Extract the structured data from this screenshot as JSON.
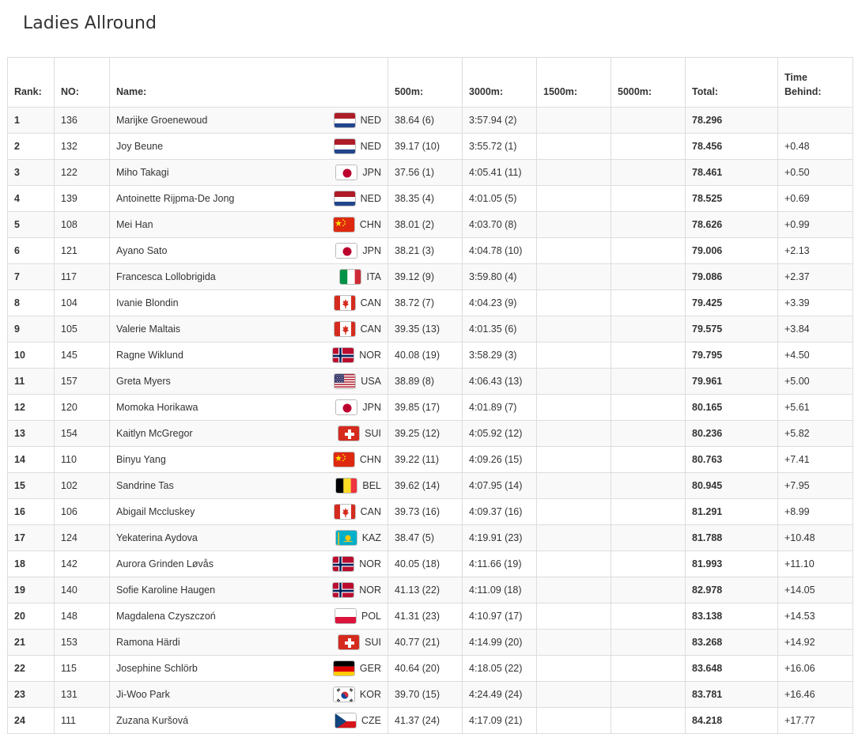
{
  "page": {
    "title": "Ladies Allround"
  },
  "table": {
    "headers": {
      "rank": "Rank:",
      "no": "NO:",
      "name": "Name:",
      "d500": "500m:",
      "d3000": "3000m:",
      "d1500": "1500m:",
      "d5000": "5000m:",
      "total": "Total:",
      "behind_line1": "Time",
      "behind_line2": "Behind:"
    },
    "rows": [
      {
        "rank": "1",
        "no": "136",
        "name": "Marijke Groenewoud",
        "country": "NED",
        "d500": "38.64 (6)",
        "d3000": "3:57.94 (2)",
        "d1500": "",
        "d5000": "",
        "total": "78.296",
        "behind": ""
      },
      {
        "rank": "2",
        "no": "132",
        "name": "Joy Beune",
        "country": "NED",
        "d500": "39.17 (10)",
        "d3000": "3:55.72 (1)",
        "d1500": "",
        "d5000": "",
        "total": "78.456",
        "behind": "+0.48"
      },
      {
        "rank": "3",
        "no": "122",
        "name": "Miho Takagi",
        "country": "JPN",
        "d500": "37.56 (1)",
        "d3000": "4:05.41 (11)",
        "d1500": "",
        "d5000": "",
        "total": "78.461",
        "behind": "+0.50"
      },
      {
        "rank": "4",
        "no": "139",
        "name": "Antoinette Rijpma-De Jong",
        "country": "NED",
        "d500": "38.35 (4)",
        "d3000": "4:01.05 (5)",
        "d1500": "",
        "d5000": "",
        "total": "78.525",
        "behind": "+0.69"
      },
      {
        "rank": "5",
        "no": "108",
        "name": "Mei Han",
        "country": "CHN",
        "d500": "38.01 (2)",
        "d3000": "4:03.70 (8)",
        "d1500": "",
        "d5000": "",
        "total": "78.626",
        "behind": "+0.99"
      },
      {
        "rank": "6",
        "no": "121",
        "name": "Ayano Sato",
        "country": "JPN",
        "d500": "38.21 (3)",
        "d3000": "4:04.78 (10)",
        "d1500": "",
        "d5000": "",
        "total": "79.006",
        "behind": "+2.13"
      },
      {
        "rank": "7",
        "no": "117",
        "name": "Francesca Lollobrigida",
        "country": "ITA",
        "d500": "39.12 (9)",
        "d3000": "3:59.80 (4)",
        "d1500": "",
        "d5000": "",
        "total": "79.086",
        "behind": "+2.37"
      },
      {
        "rank": "8",
        "no": "104",
        "name": "Ivanie Blondin",
        "country": "CAN",
        "d500": "38.72 (7)",
        "d3000": "4:04.23 (9)",
        "d1500": "",
        "d5000": "",
        "total": "79.425",
        "behind": "+3.39"
      },
      {
        "rank": "9",
        "no": "105",
        "name": "Valerie Maltais",
        "country": "CAN",
        "d500": "39.35 (13)",
        "d3000": "4:01.35 (6)",
        "d1500": "",
        "d5000": "",
        "total": "79.575",
        "behind": "+3.84"
      },
      {
        "rank": "10",
        "no": "145",
        "name": "Ragne Wiklund",
        "country": "NOR",
        "d500": "40.08 (19)",
        "d3000": "3:58.29 (3)",
        "d1500": "",
        "d5000": "",
        "total": "79.795",
        "behind": "+4.50"
      },
      {
        "rank": "11",
        "no": "157",
        "name": "Greta Myers",
        "country": "USA",
        "d500": "38.89 (8)",
        "d3000": "4:06.43 (13)",
        "d1500": "",
        "d5000": "",
        "total": "79.961",
        "behind": "+5.00"
      },
      {
        "rank": "12",
        "no": "120",
        "name": "Momoka Horikawa",
        "country": "JPN",
        "d500": "39.85 (17)",
        "d3000": "4:01.89 (7)",
        "d1500": "",
        "d5000": "",
        "total": "80.165",
        "behind": "+5.61"
      },
      {
        "rank": "13",
        "no": "154",
        "name": "Kaitlyn McGregor",
        "country": "SUI",
        "d500": "39.25 (12)",
        "d3000": "4:05.92 (12)",
        "d1500": "",
        "d5000": "",
        "total": "80.236",
        "behind": "+5.82"
      },
      {
        "rank": "14",
        "no": "110",
        "name": "Binyu Yang",
        "country": "CHN",
        "d500": "39.22 (11)",
        "d3000": "4:09.26 (15)",
        "d1500": "",
        "d5000": "",
        "total": "80.763",
        "behind": "+7.41"
      },
      {
        "rank": "15",
        "no": "102",
        "name": "Sandrine Tas",
        "country": "BEL",
        "d500": "39.62 (14)",
        "d3000": "4:07.95 (14)",
        "d1500": "",
        "d5000": "",
        "total": "80.945",
        "behind": "+7.95"
      },
      {
        "rank": "16",
        "no": "106",
        "name": "Abigail Mccluskey",
        "country": "CAN",
        "d500": "39.73 (16)",
        "d3000": "4:09.37 (16)",
        "d1500": "",
        "d5000": "",
        "total": "81.291",
        "behind": "+8.99"
      },
      {
        "rank": "17",
        "no": "124",
        "name": "Yekaterina Aydova",
        "country": "KAZ",
        "d500": "38.47 (5)",
        "d3000": "4:19.91 (23)",
        "d1500": "",
        "d5000": "",
        "total": "81.788",
        "behind": "+10.48"
      },
      {
        "rank": "18",
        "no": "142",
        "name": "Aurora Grinden Løvås",
        "country": "NOR",
        "d500": "40.05 (18)",
        "d3000": "4:11.66 (19)",
        "d1500": "",
        "d5000": "",
        "total": "81.993",
        "behind": "+11.10"
      },
      {
        "rank": "19",
        "no": "140",
        "name": "Sofie Karoline Haugen",
        "country": "NOR",
        "d500": "41.13 (22)",
        "d3000": "4:11.09 (18)",
        "d1500": "",
        "d5000": "",
        "total": "82.978",
        "behind": "+14.05"
      },
      {
        "rank": "20",
        "no": "148",
        "name": "Magdalena Czyszczoń",
        "country": "POL",
        "d500": "41.31 (23)",
        "d3000": "4:10.97 (17)",
        "d1500": "",
        "d5000": "",
        "total": "83.138",
        "behind": "+14.53"
      },
      {
        "rank": "21",
        "no": "153",
        "name": "Ramona Härdi",
        "country": "SUI",
        "d500": "40.77 (21)",
        "d3000": "4:14.99 (20)",
        "d1500": "",
        "d5000": "",
        "total": "83.268",
        "behind": "+14.92"
      },
      {
        "rank": "22",
        "no": "115",
        "name": "Josephine Schlörb",
        "country": "GER",
        "d500": "40.64 (20)",
        "d3000": "4:18.05 (22)",
        "d1500": "",
        "d5000": "",
        "total": "83.648",
        "behind": "+16.06"
      },
      {
        "rank": "23",
        "no": "131",
        "name": "Ji-Woo Park",
        "country": "KOR",
        "d500": "39.70 (15)",
        "d3000": "4:24.49 (24)",
        "d1500": "",
        "d5000": "",
        "total": "83.781",
        "behind": "+16.46"
      },
      {
        "rank": "24",
        "no": "111",
        "name": "Zuzana Kuršová",
        "country": "CZE",
        "d500": "41.37 (24)",
        "d3000": "4:17.09 (21)",
        "d1500": "",
        "d5000": "",
        "total": "84.218",
        "behind": "+17.77"
      }
    ]
  }
}
